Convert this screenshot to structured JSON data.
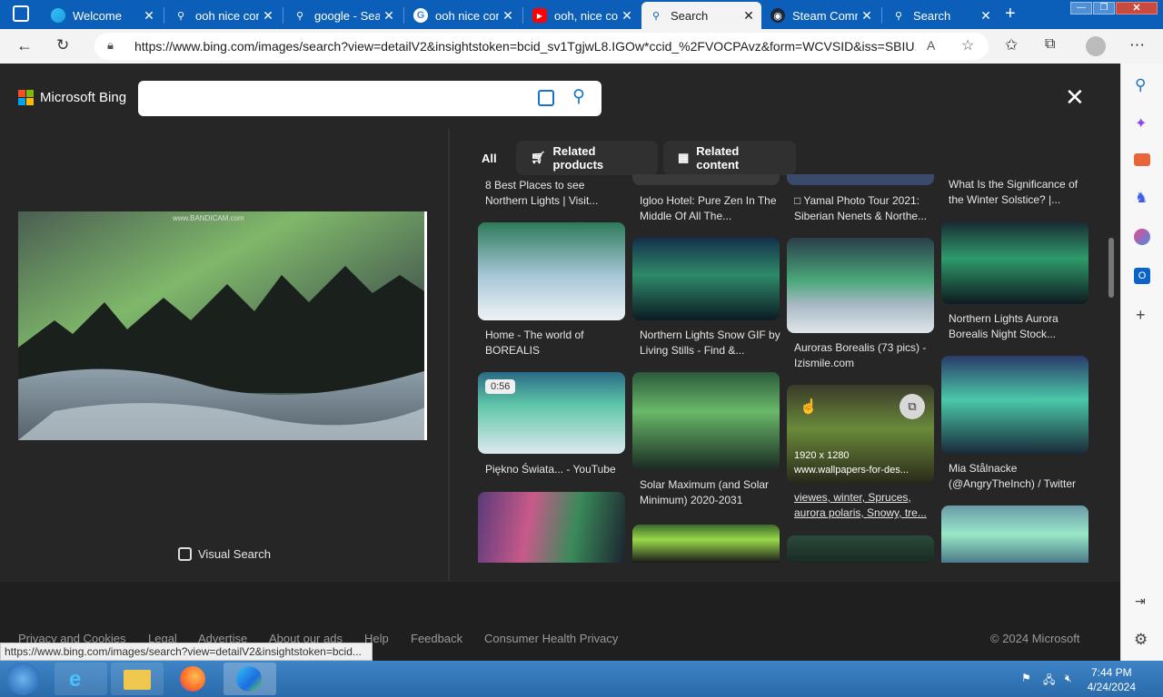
{
  "browser": {
    "tabs": [
      {
        "title": "Welcome",
        "icon": "edge-icon",
        "color": "#ffffff"
      },
      {
        "title": "ooh nice comment",
        "icon": "search-icon",
        "color": "#ffffff"
      },
      {
        "title": "google - Search",
        "icon": "search-icon",
        "color": "#ffffff"
      },
      {
        "title": "ooh nice comment",
        "icon": "google-icon",
        "color": "#ffffff"
      },
      {
        "title": "ooh, nice comment",
        "icon": "youtube-icon",
        "color": "#ff0000"
      },
      {
        "title": "Search",
        "icon": "search-icon",
        "color": "#0b5fb8"
      },
      {
        "title": "Steam Community",
        "icon": "steam-icon",
        "color": "#1b2838"
      },
      {
        "title": "Search",
        "icon": "search-icon",
        "color": "#ffffff"
      }
    ],
    "url": "https://www.bing.com/images/search?view=detailV2&insightstoken=bcid_sv1TgjwL8.IGOw*ccid_%2FVOCPAvz&form=WCVSID&iss=SBIU..."
  },
  "bing": {
    "logo_text": "Microsoft Bing",
    "search_value": "",
    "visual_search_label": "Visual Search",
    "filters": [
      "All",
      "Related products",
      "Related content"
    ]
  },
  "results": {
    "col1": [
      {
        "caption": "8 Best Places to see Northern Lights | Visit..."
      },
      {
        "caption": "Home - The world of BOREALIS"
      },
      {
        "caption": "Piękno Świata... - YouTube",
        "badge": "0:56"
      }
    ],
    "col2": [
      {
        "caption": "Igloo Hotel: Pure Zen In The Middle Of All The..."
      },
      {
        "caption": "Northern Lights Snow GIF by Living Stills - Find &..."
      },
      {
        "caption": "Solar Maximum (and Solar Minimum) 2020-2031"
      }
    ],
    "col3": [
      {
        "caption": "□ Yamal Photo Tour 2021: Siberian Nenets & Northe..."
      },
      {
        "caption": "Auroras Borealis (73 pics) - Izismile.com"
      },
      {
        "caption": "viewes, winter, Spruces, aurora polaris, Snowy, tre...",
        "dims": "1920 x 1280",
        "site": "www.wallpapers-for-des..."
      }
    ],
    "col4": [
      {
        "caption": "What Is the Significance of the Winter Solstice? |..."
      },
      {
        "caption": "Northern Lights Aurora Borealis Night Stock..."
      },
      {
        "caption": "Mia Stålnacke (@AngryTheInch) / Twitter"
      }
    ]
  },
  "footer": {
    "links": [
      "Privacy and Cookies",
      "Legal",
      "Advertise",
      "About our ads",
      "Help",
      "Feedback",
      "Consumer Health Privacy"
    ],
    "copyright": "© 2024 Microsoft"
  },
  "status_url": "https://www.bing.com/images/search?view=detailV2&insightstoken=bcid...",
  "taskbar": {
    "time": "7:44 PM",
    "date": "4/24/2024"
  }
}
